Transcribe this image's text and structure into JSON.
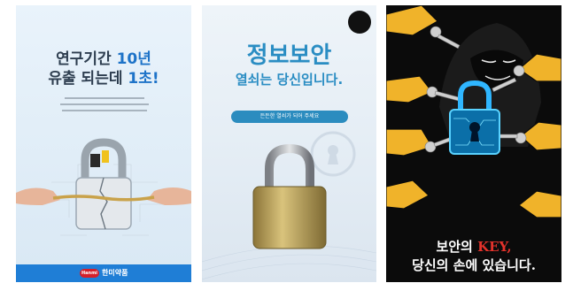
{
  "panel1": {
    "headline_line1_prefix": "연구기간 ",
    "headline_line1_highlight": "10년",
    "headline_line2_prefix": "유출 되는데 ",
    "headline_line2_highlight": "1초!",
    "brand_logo": "Hanmi",
    "brand_name": "한미약품",
    "colors": {
      "highlight": "#1e73c8",
      "footer": "#1f7ed6"
    }
  },
  "panel2": {
    "title": "정보보안",
    "subtitle": "열쇠는 당신입니다.",
    "pill_text": "든든한 열쇠가 되어 주세요",
    "colors": {
      "title": "#2a8dc3"
    }
  },
  "panel3": {
    "caption_line1_prefix": "보안의 ",
    "caption_line1_key": "KEY,",
    "caption_line2": "당신의 손에 있습니다.",
    "colors": {
      "hand": "#f0b32a",
      "lock_glow": "#2fb6ff",
      "key_word": "#e3322b"
    }
  }
}
